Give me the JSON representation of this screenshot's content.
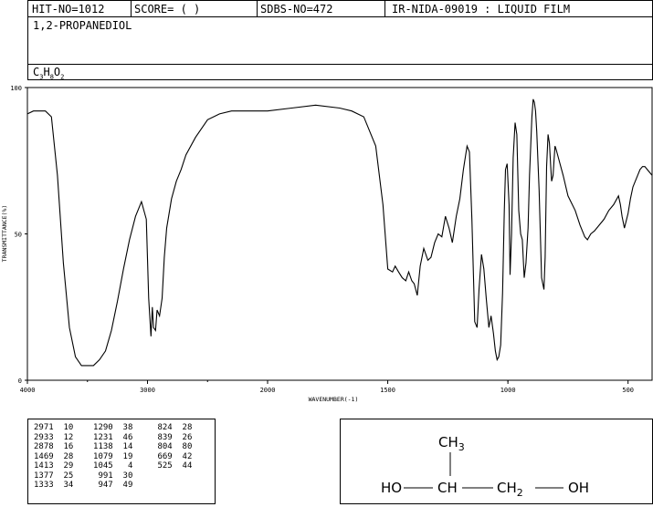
{
  "header": {
    "hit_no": "HIT-NO=1012",
    "score": "SCORE=  (   )",
    "sdbs_no": "SDBS-NO=472",
    "ir_nida": "IR-NIDA-09019 : LIQUID FILM"
  },
  "compound": {
    "name": "1,2-PROPANEDIOL",
    "formula_parts": [
      "C",
      "3",
      "H",
      "8",
      "O",
      "2"
    ]
  },
  "chart_data": {
    "type": "line",
    "xlabel": "WAVENUMBER(-1)",
    "ylabel": "TRANSMITTANCE(%)",
    "xlim": [
      4000,
      400
    ],
    "ylim": [
      0,
      100
    ],
    "x_ticks": [
      "4000",
      "3000",
      "2000",
      "1500",
      "1000",
      "500"
    ],
    "y_ticks": [
      "100",
      "50",
      "0"
    ],
    "series": [
      {
        "x": [
          4000,
          3950,
          3850,
          3800,
          3750,
          3700,
          3650,
          3600,
          3550,
          3500,
          3450,
          3400,
          3350,
          3300,
          3250,
          3200,
          3150,
          3100,
          3050,
          3010,
          2990,
          2971,
          2960,
          2950,
          2933,
          2920,
          2900,
          2878,
          2860,
          2840,
          2800,
          2760,
          2720,
          2680,
          2600,
          2500,
          2400,
          2300,
          2200,
          2100,
          2000,
          1900,
          1800,
          1700,
          1650,
          1600,
          1550,
          1520,
          1500,
          1480,
          1469,
          1455,
          1440,
          1425,
          1413,
          1400,
          1390,
          1377,
          1365,
          1350,
          1333,
          1320,
          1305,
          1290,
          1275,
          1260,
          1245,
          1231,
          1215,
          1200,
          1185,
          1170,
          1160,
          1150,
          1138,
          1128,
          1120,
          1110,
          1100,
          1090,
          1079,
          1070,
          1060,
          1052,
          1045,
          1038,
          1030,
          1022,
          1015,
          1010,
          1003,
          995,
          991,
          985,
          978,
          970,
          963,
          955,
          947,
          940,
          932,
          925,
          916,
          910,
          905,
          900,
          895,
          890,
          885,
          880,
          870,
          860,
          850,
          845,
          839,
          833,
          827,
          822,
          818,
          812,
          808,
          804,
          800,
          790,
          770,
          750,
          720,
          700,
          680,
          669,
          655,
          640,
          620,
          600,
          580,
          560,
          540,
          532,
          525,
          515,
          500,
          490,
          480,
          470,
          460,
          450,
          440,
          430,
          420,
          410,
          400
        ],
        "y": [
          91,
          92,
          92,
          90,
          70,
          40,
          18,
          8,
          5,
          5,
          5,
          7,
          10,
          17,
          27,
          38,
          48,
          56,
          61,
          55,
          28,
          15,
          25,
          18,
          17,
          24,
          22,
          28,
          42,
          52,
          62,
          68,
          72,
          77,
          83,
          89,
          91,
          92,
          92,
          92,
          92,
          93,
          94,
          93,
          92,
          90,
          80,
          60,
          38,
          37,
          39,
          37,
          35,
          34,
          37,
          34,
          33,
          29,
          39,
          45,
          41,
          42,
          47,
          50,
          49,
          56,
          52,
          47,
          56,
          62,
          72,
          80,
          78,
          55,
          20,
          18,
          31,
          43,
          38,
          28,
          18,
          22,
          16,
          10,
          7,
          8,
          12,
          30,
          58,
          72,
          74,
          60,
          36,
          50,
          76,
          88,
          84,
          58,
          50,
          48,
          35,
          40,
          52,
          70,
          80,
          90,
          96,
          95,
          92,
          85,
          65,
          35,
          31,
          42,
          73,
          84,
          81,
          73,
          68,
          70,
          75,
          80,
          79,
          76,
          70,
          63,
          58,
          53,
          49,
          48,
          50,
          51,
          53,
          55,
          58,
          60,
          63,
          60,
          56,
          52,
          57,
          62,
          66,
          68,
          70,
          72,
          73,
          73,
          72,
          71,
          70
        ]
      }
    ]
  },
  "peak_table": {
    "rows": [
      [
        [
          "2971",
          "10"
        ],
        [
          "1290",
          "38"
        ],
        [
          "824",
          "28"
        ]
      ],
      [
        [
          "2933",
          "12"
        ],
        [
          "1231",
          "46"
        ],
        [
          "839",
          "26"
        ]
      ],
      [
        [
          "2878",
          "16"
        ],
        [
          "1138",
          "14"
        ],
        [
          "804",
          "80"
        ]
      ],
      [
        [
          "1469",
          "28"
        ],
        [
          "1079",
          "19"
        ],
        [
          "669",
          "42"
        ]
      ],
      [
        [
          "1413",
          "29"
        ],
        [
          "1045",
          "4"
        ],
        [
          "525",
          "44"
        ]
      ],
      [
        [
          "1377",
          "25"
        ],
        [
          "991",
          "30"
        ],
        [
          "",
          ""
        ]
      ],
      [
        [
          "1333",
          "34"
        ],
        [
          "947",
          "49"
        ],
        [
          "",
          ""
        ]
      ]
    ]
  },
  "structure": {
    "ch3": "CH",
    "ch3_sub": "3",
    "ho": "HO",
    "ch": "CH",
    "ch2": "CH",
    "ch2_sub": "2",
    "oh": "OH"
  }
}
